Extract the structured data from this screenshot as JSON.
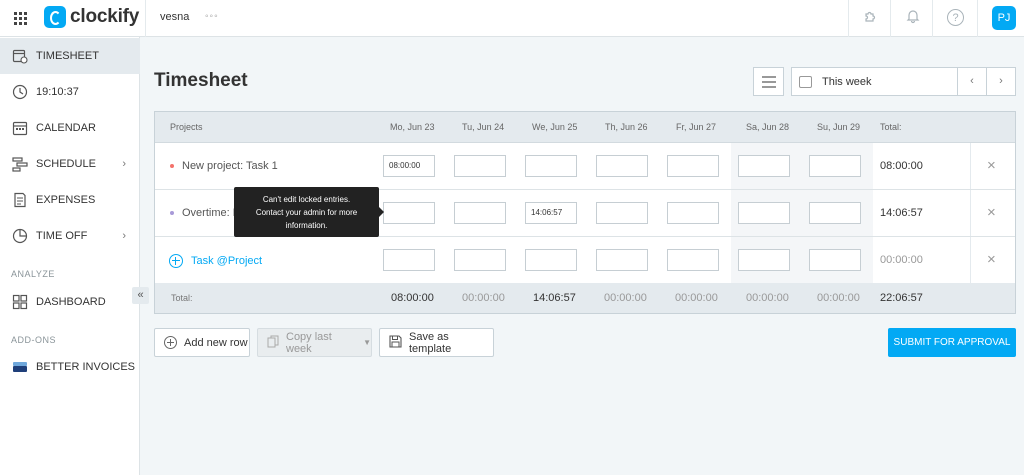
{
  "brand": {
    "name": "clockify",
    "accent": "#03a9f4"
  },
  "header": {
    "workspace": "vesna",
    "more": "◦◦◦",
    "help": "?",
    "user_initials": "PJ"
  },
  "sidebar": {
    "items": [
      {
        "label": "TIMESHEET",
        "icon": "timesheet-icon",
        "active": true
      },
      {
        "label": "19:10:37",
        "icon": "clock-icon"
      },
      {
        "label": "CALENDAR",
        "icon": "calendar-icon"
      },
      {
        "label": "SCHEDULE",
        "icon": "schedule-icon",
        "chevron": "›"
      },
      {
        "label": "EXPENSES",
        "icon": "expenses-icon"
      },
      {
        "label": "TIME OFF",
        "icon": "time-off-icon",
        "chevron": "›"
      }
    ],
    "analyze_label": "ANALYZE",
    "dashboard_label": "DASHBOARD",
    "addons_label": "ADD-ONS",
    "better_invoices_label": "BETTER INVOICES",
    "collapse": "«"
  },
  "main": {
    "title": "Timesheet",
    "week_label": "This week",
    "prev": "‹",
    "next": "›"
  },
  "table": {
    "headers": {
      "project": "Projects",
      "days": [
        "Mo, Jun 23",
        "Tu, Jun 24",
        "We, Jun 25",
        "Th, Jun 26",
        "Fr, Jun 27",
        "Sa, Jun 28",
        "Su, Jun 29"
      ],
      "total": "Total:"
    },
    "rows": [
      {
        "project": "New project: Task 1",
        "dot_color": "#f4726b",
        "values": [
          "08:00:00",
          "",
          "",
          "",
          "",
          "",
          ""
        ],
        "total": "08:00:00"
      },
      {
        "project": "Overtime: E",
        "dot_color": "#a89ad8",
        "values": [
          "",
          "",
          "14:06:57",
          "",
          "",
          "",
          ""
        ],
        "total": "14:06:57"
      },
      {
        "project": "Task @Project",
        "values": [
          "",
          "",
          "",
          "",
          "",
          "",
          ""
        ],
        "total": "00:00:00"
      }
    ],
    "footer": {
      "label": "Total:",
      "days": [
        "08:00:00",
        "00:00:00",
        "14:06:57",
        "00:00:00",
        "00:00:00",
        "00:00:00",
        "00:00:00"
      ],
      "total": "22:06:57"
    },
    "remove": "×"
  },
  "tooltip": {
    "line1": "Can't edit locked entries.",
    "line2": "Contact your admin for more",
    "line3": "information."
  },
  "actions": {
    "add_row": "Add new row",
    "copy_last_week": "Copy last week",
    "save_template": "Save as template",
    "submit": "SUBMIT FOR APPROVAL"
  }
}
